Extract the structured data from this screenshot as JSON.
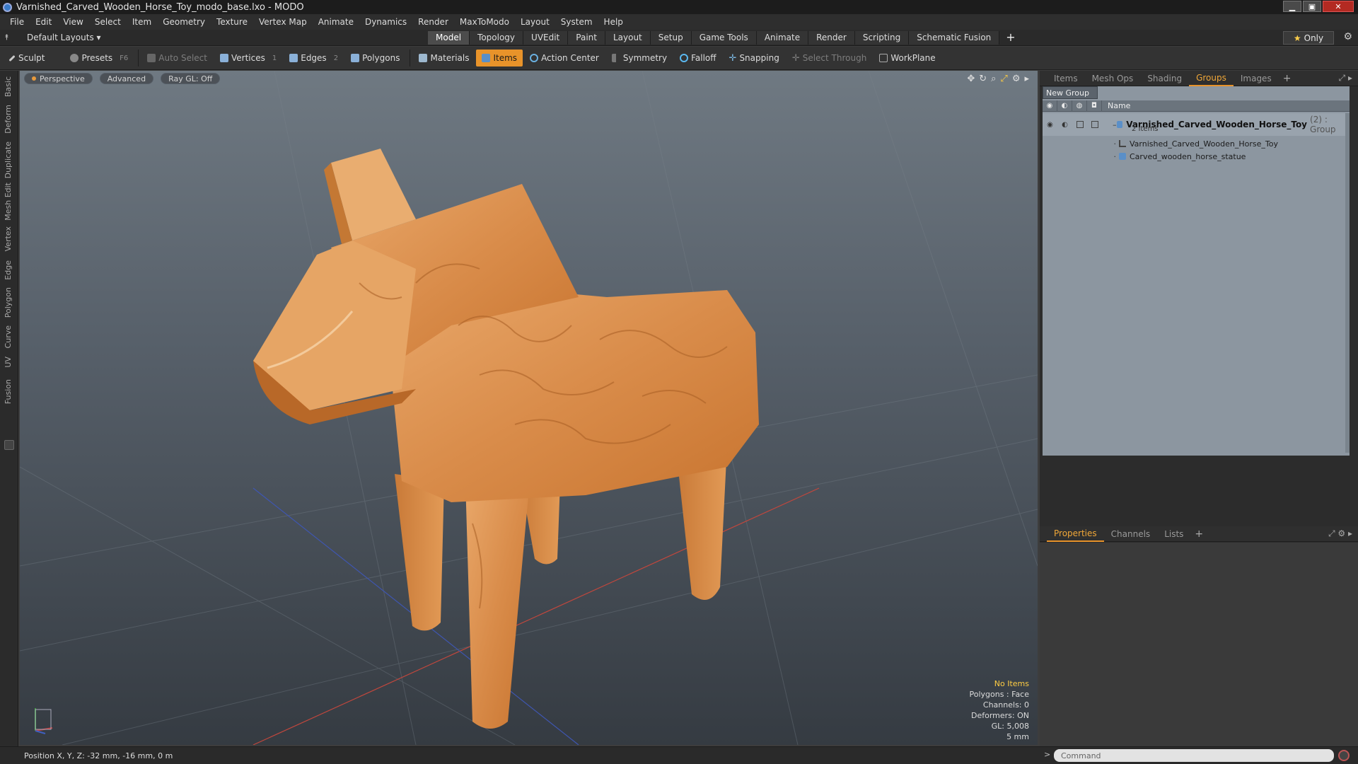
{
  "window": {
    "title": "Varnished_Carved_Wooden_Horse_Toy_modo_base.lxo - MODO",
    "min": "▁",
    "max": "▣",
    "close": "✕"
  },
  "menu": [
    "File",
    "Edit",
    "View",
    "Select",
    "Item",
    "Geometry",
    "Texture",
    "Vertex Map",
    "Animate",
    "Dynamics",
    "Render",
    "MaxToModo",
    "Layout",
    "System",
    "Help"
  ],
  "layoutbar": {
    "layouts_label": "Default Layouts ▾",
    "tabs": [
      "Model",
      "Topology",
      "UVEdit",
      "Paint",
      "Layout",
      "Setup",
      "Game Tools",
      "Animate",
      "Render",
      "Scripting",
      "Schematic Fusion"
    ],
    "active_tab": "Model",
    "only_label": "Only"
  },
  "toolbar": {
    "sculpt": "Sculpt",
    "presets": "Presets",
    "presets_key": "F6",
    "auto_select": "Auto Select",
    "vertices": "Vertices",
    "vertices_key": "1",
    "edges": "Edges",
    "edges_key": "2",
    "polygons": "Polygons",
    "materials": "Materials",
    "items": "Items",
    "action_center": "Action Center",
    "symmetry": "Symmetry",
    "falloff": "Falloff",
    "snapping": "Snapping",
    "select_through": "Select Through",
    "workplane": "WorkPlane"
  },
  "left_tabs": [
    "Basic",
    "Deform",
    "Duplicate",
    "Mesh Edit",
    "Vertex",
    "Edge",
    "Polygon",
    "Curve",
    "UV",
    "Fusion"
  ],
  "viewport": {
    "view_mode": "Perspective",
    "shading": "Advanced",
    "raygl": "Ray GL: Off",
    "info": {
      "items": "No Items",
      "polygons": "Polygons : Face",
      "channels": "Channels: 0",
      "deformers": "Deformers: ON",
      "gl": "GL: 5,008",
      "unit": "5 mm"
    }
  },
  "right_tabs": [
    "Items",
    "Mesh Ops",
    "Shading",
    "Groups",
    "Images"
  ],
  "right_active": "Groups",
  "groups": {
    "new_group": "New Group",
    "column_name": "Name",
    "group_name": "Varnished_Carved_Wooden_Horse_Toy",
    "group_meta": "(2) : Group",
    "group_sub": "2 Items",
    "children": [
      "Varnished_Carved_Wooden_Horse_Toy",
      "Carved_wooden_horse_statue"
    ]
  },
  "prop_tabs": [
    "Properties",
    "Channels",
    "Lists"
  ],
  "prop_active": "Properties",
  "status": {
    "position": "Position X, Y, Z:  -32 mm, -16 mm, 0 m",
    "command_placeholder": "Command"
  }
}
